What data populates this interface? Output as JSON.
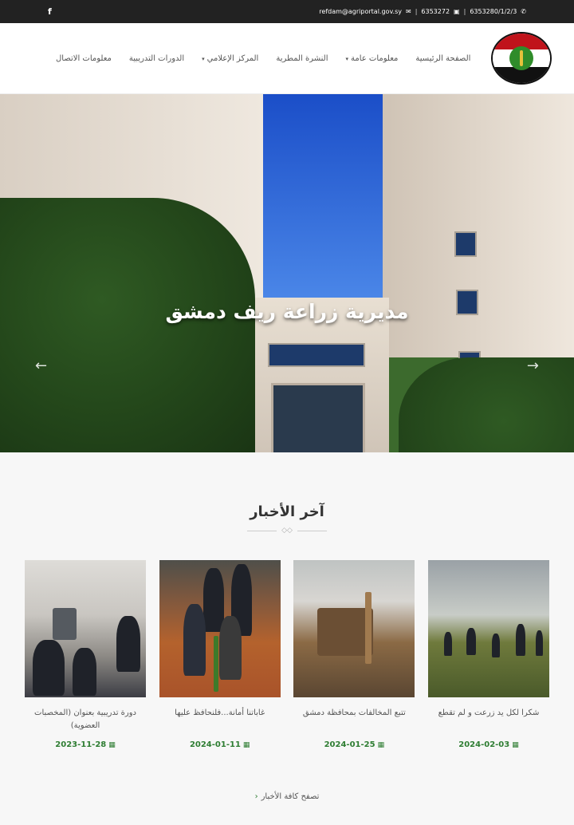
{
  "topbar": {
    "phone_icon": "phone-icon",
    "phone": "6353280/1/2/3",
    "fax_icon": "fax-icon",
    "fax": "6353272",
    "email_icon": "envelope-icon",
    "email": "refdam@agriportal.gov.sy",
    "facebook_icon": "facebook-icon",
    "facebook": "f"
  },
  "nav": {
    "items": [
      {
        "label": "الصفحة الرئيسية"
      },
      {
        "label": "معلومات عامة",
        "dropdown": true
      },
      {
        "label": "النشرة المطرية"
      },
      {
        "label": "المركز الإعلامي",
        "dropdown": true
      },
      {
        "label": "الدورات التدريبية"
      },
      {
        "label": "معلومات الاتصال"
      }
    ],
    "caret": "▾"
  },
  "hero": {
    "title": "مديرية زراعة ريف دمشق",
    "prev_arrow": "←",
    "next_arrow": "→"
  },
  "news": {
    "heading": "آخر الأخبار",
    "divider_icon": "◇◇",
    "items": [
      {
        "title": "شكرا لكل يد زرعت و لم تقطع",
        "date": "2024-02-03"
      },
      {
        "title": "تتبع المخالفات بمحافظة دمشق",
        "date": "2024-01-25"
      },
      {
        "title": "غاباتنا أمانة...فلنحافظ عليها",
        "date": "2024-01-11"
      },
      {
        "title": "دورة تدريبية بعنوان (المخصبات العضوية)",
        "date": "2023-11-28"
      }
    ],
    "calendar_icon": "▦",
    "browse_label": "تصفح كافة الأخبار",
    "browse_chevron": "‹"
  },
  "colors": {
    "topbar": "#222222",
    "accent_green": "#2e7d32",
    "logo_red": "#c0131b"
  }
}
